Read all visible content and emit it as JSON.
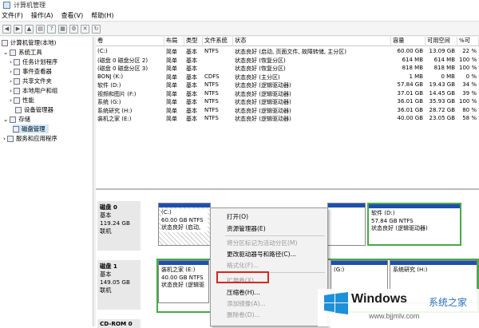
{
  "window": {
    "title": "计算机管理"
  },
  "menu": [
    "文件(F)",
    "操作(A)",
    "查看(V)",
    "帮助(H)"
  ],
  "tree": {
    "root": "计算机管理(本地)",
    "system_tools": "系统工具",
    "items": [
      "任务计划程序",
      "事件查看器",
      "共享文件夹",
      "本地用户和组",
      "性能",
      "设备管理器"
    ],
    "storage": "存储",
    "disk_mgmt": "磁盘管理",
    "services": "服务和应用程序"
  },
  "table": {
    "headers": [
      "卷",
      "布局",
      "类型",
      "文件系统",
      "状态",
      "容量",
      "可用空间",
      "%可"
    ],
    "rows": [
      [
        "(C:)",
        "简单",
        "基本",
        "NTFS",
        "状态良好 (启动, 页面文件, 故障转储, 主分区)",
        "60.00 GB",
        "13.09 GB",
        "22 %"
      ],
      [
        "(磁盘 0 磁盘分区 2)",
        "简单",
        "基本",
        "",
        "状态良好 (恢复分区)",
        "614 MB",
        "614 MB",
        "100 %"
      ],
      [
        "(磁盘 0 磁盘分区 3)",
        "简单",
        "基本",
        "",
        "状态良好 (恢复分区)",
        "818 MB",
        "818 MB",
        "100 %"
      ],
      [
        "BONJ (K:)",
        "简单",
        "基本",
        "CDFS",
        "状态良好 (主分区)",
        "1 MB",
        "0 MB",
        "0 %"
      ],
      [
        "软件 (D:)",
        "简单",
        "基本",
        "NTFS",
        "状态良好 (逻辑驱动器)",
        "57.84 GB",
        "19.43 GB",
        "34 %"
      ],
      [
        "视频和图片 (F:)",
        "简单",
        "基本",
        "NTFS",
        "状态良好 (逻辑驱动器)",
        "37.01 GB",
        "14.45 GB",
        "39 %"
      ],
      [
        "系统 (G:)",
        "简单",
        "基本",
        "NTFS",
        "状态良好 (逻辑驱动器)",
        "36.01 GB",
        "35.93 GB",
        "100 %"
      ],
      [
        "系统研究 (H:)",
        "简单",
        "基本",
        "NTFS",
        "状态良好 (逻辑驱动器)",
        "36.01 GB",
        "28.72 GB",
        "80 %"
      ],
      [
        "装机之家 (E:)",
        "简单",
        "基本",
        "NTFS",
        "状态良好 (逻辑驱动器)",
        "40.00 GB",
        "23.05 GB",
        "58 %"
      ]
    ]
  },
  "disks": [
    {
      "name": "磁盘 0",
      "type": "基本",
      "size": "119.24 GB",
      "state": "联机"
    },
    {
      "name": "磁盘 1",
      "type": "基本",
      "size": "149.05 GB",
      "state": "联机"
    },
    {
      "name": "CD-ROM 0"
    }
  ],
  "partitions": {
    "c_name": "(C:)",
    "c_size": "60.00 GB NTFS",
    "c_state": "状态良好 (启动,",
    "d_name": "软件 (D:)",
    "d_size": "57.84 GB NTFS",
    "d_state": "状态良好 (逻辑驱动器)",
    "e_name": "装机之家 (E:)",
    "e_size": "40.00 GB NTFS",
    "e_state": "状态良好 (逻辑驱",
    "g_name": "(G:)",
    "h_name": "系统研究 (H:)"
  },
  "context_menu": [
    {
      "label": "打开(O)",
      "disabled": false
    },
    {
      "label": "资源管理器(E)",
      "disabled": false
    },
    {
      "label": "将分区标记为活动分区(M)",
      "disabled": true
    },
    {
      "label": "更改驱动器号和路径(C)...",
      "disabled": false
    },
    {
      "label": "格式化(F)...",
      "disabled": true
    },
    {
      "label": "扩展卷(X)...",
      "disabled": true
    },
    {
      "label": "压缩卷(H)...",
      "disabled": false
    },
    {
      "label": "添加镜像(A)...",
      "disabled": true
    },
    {
      "label": "删除卷(D)...",
      "disabled": true
    }
  ],
  "watermark": {
    "brand": "Windows",
    "suffix": "系统之家",
    "url": "www.bjjmlv.com"
  }
}
